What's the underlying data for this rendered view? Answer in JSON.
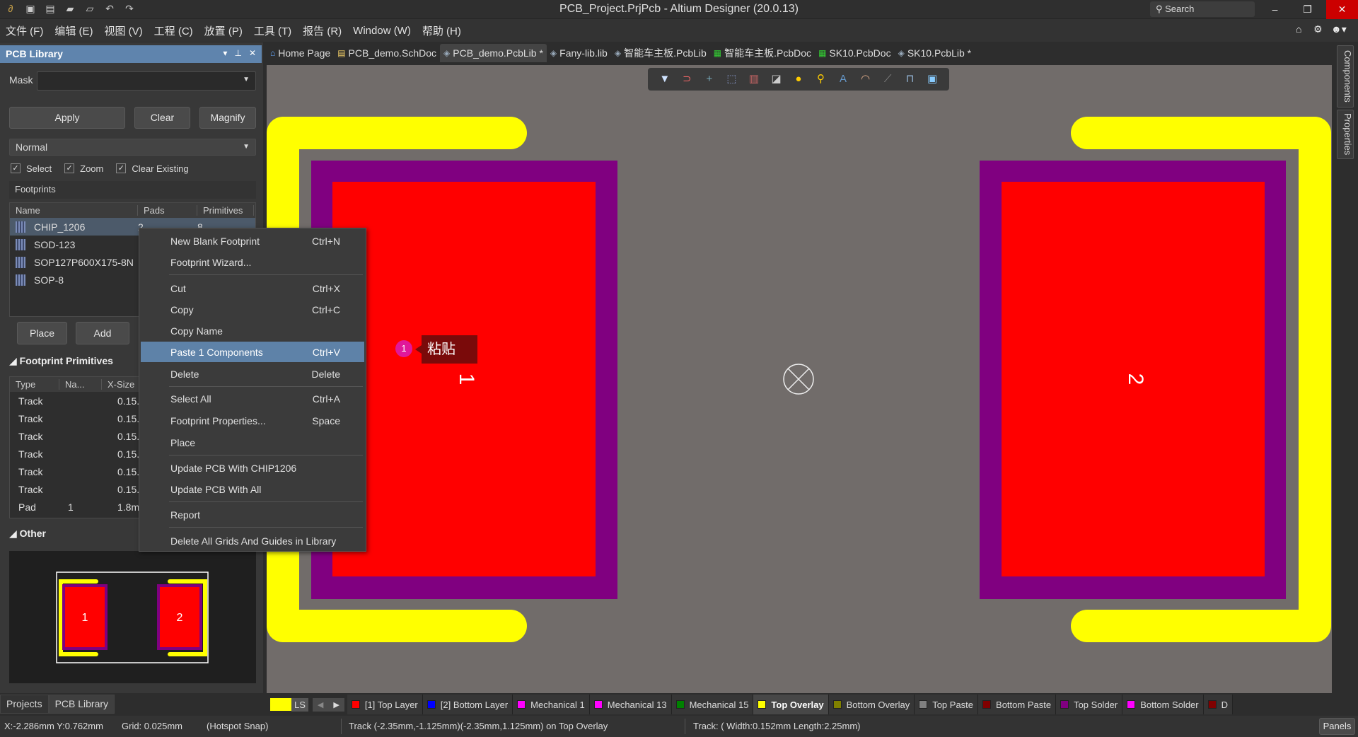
{
  "app": {
    "title": "PCB_Project.PrjPcb - Altium Designer (20.0.13)",
    "search_placeholder": "Search"
  },
  "quick_icons": [
    "app-logo-icon",
    "save-icon",
    "save-all-icon",
    "open-icon",
    "open-project-icon",
    "undo-icon",
    "redo-icon"
  ],
  "menu": [
    "文件 (F)",
    "编辑 (E)",
    "视图 (V)",
    "工程 (C)",
    "放置 (P)",
    "工具 (T)",
    "报告 (R)",
    "Window (W)",
    "帮助 (H)"
  ],
  "panel": {
    "title": "PCB Library",
    "mask_label": "Mask",
    "mask_value": "",
    "buttons": {
      "apply": "Apply",
      "clear": "Clear",
      "magnify": "Magnify"
    },
    "filter_mode": "Normal",
    "checks": [
      {
        "label": "Select",
        "checked": true
      },
      {
        "label": "Zoom",
        "checked": true
      },
      {
        "label": "Clear Existing",
        "checked": true
      }
    ],
    "footprints_label": "Footprints",
    "footprint_columns": [
      "Name",
      "Pads",
      "Primitives"
    ],
    "footprints": [
      {
        "name": "CHIP_1206",
        "pads": "2",
        "primitives": "8"
      },
      {
        "name": "SOD-123",
        "pads": "",
        "primitives": ""
      },
      {
        "name": "SOP127P600X175-8N",
        "pads": "",
        "primitives": ""
      },
      {
        "name": "SOP-8",
        "pads": "",
        "primitives": ""
      }
    ],
    "place": "Place",
    "add": "Add",
    "primitives_label": "Footprint Primitives",
    "primitive_columns": [
      "Type",
      "Na...",
      "X-Size"
    ],
    "primitives": [
      [
        "Track",
        "",
        "0.15..."
      ],
      [
        "Track",
        "",
        "0.15..."
      ],
      [
        "Track",
        "",
        "0.15..."
      ],
      [
        "Track",
        "",
        "0.15..."
      ],
      [
        "Track",
        "",
        "0.15..."
      ],
      [
        "Track",
        "",
        "0.15..."
      ],
      [
        "Pad",
        "1",
        "1.8m..."
      ]
    ],
    "other_label": "Other",
    "preview_pads": [
      "1",
      "2"
    ],
    "bottom_tabs": [
      "Projects",
      "PCB Library"
    ]
  },
  "doc_tabs": [
    {
      "label": "Home Page",
      "icon": "home-icon",
      "active": false
    },
    {
      "label": "PCB_demo.SchDoc",
      "icon": "schematic-icon",
      "active": false
    },
    {
      "label": "PCB_demo.PcbLib *",
      "icon": "pcblib-icon",
      "active": true
    },
    {
      "label": "Fany-lib.lib",
      "icon": "pcblib-icon",
      "active": false
    },
    {
      "label": "智能车主板.PcbLib",
      "icon": "pcblib-icon",
      "active": false
    },
    {
      "label": "智能车主板.PcbDoc",
      "icon": "pcbdoc-icon",
      "active": false
    },
    {
      "label": "SK10.PcbDoc",
      "icon": "pcbdoc-icon",
      "active": false
    },
    {
      "label": "SK10.PcbLib *",
      "icon": "pcblib-icon",
      "active": false
    }
  ],
  "toolbar": [
    "filter-icon",
    "route-icon",
    "crosshair-icon",
    "select-rect-icon",
    "align-icon",
    "component-icon",
    "pad-icon",
    "via-icon",
    "text-icon",
    "arc-icon",
    "line-icon",
    "dimension-icon",
    "area-icon"
  ],
  "right_tabs": [
    "Components",
    "Properties"
  ],
  "canvas": {
    "pad_labels": [
      "1",
      "2"
    ],
    "colors": {
      "overlay": "#ffff00",
      "solder": "#800080",
      "top_layer": "#ff0000",
      "background": "#716c6a"
    }
  },
  "context_menu": [
    {
      "label": "New Blank Footprint",
      "shortcut": "Ctrl+N"
    },
    {
      "label": "Footprint Wizard...",
      "shortcut": ""
    },
    {
      "label": "Cut",
      "shortcut": "Ctrl+X"
    },
    {
      "label": "Copy",
      "shortcut": "Ctrl+C"
    },
    {
      "label": "Copy Name",
      "shortcut": ""
    },
    {
      "label": "Paste 1 Components",
      "shortcut": "Ctrl+V",
      "highlighted": true
    },
    {
      "label": "Delete",
      "shortcut": "Delete"
    },
    {
      "label": "Select All",
      "shortcut": "Ctrl+A"
    },
    {
      "label": "Footprint Properties...",
      "shortcut": "Space"
    },
    {
      "label": "Place",
      "shortcut": ""
    },
    {
      "label": "Update PCB With CHIP1206",
      "shortcut": ""
    },
    {
      "label": "Update PCB With All",
      "shortcut": ""
    },
    {
      "label": "Report",
      "shortcut": ""
    },
    {
      "label": "Delete All Grids And Guides in Library",
      "shortcut": ""
    }
  ],
  "annotation": {
    "number": "1",
    "text": "粘贴"
  },
  "layers": {
    "current_color": "#ffff00",
    "ls": "LS",
    "tabs": [
      {
        "label": "[1] Top Layer",
        "color": "#ff0000"
      },
      {
        "label": "[2] Bottom Layer",
        "color": "#0000ff"
      },
      {
        "label": "Mechanical 1",
        "color": "#ff00ff"
      },
      {
        "label": "Mechanical 13",
        "color": "#ff00ff"
      },
      {
        "label": "Mechanical 15",
        "color": "#008000"
      },
      {
        "label": "Top Overlay",
        "color": "#ffff00",
        "active": true
      },
      {
        "label": "Bottom Overlay",
        "color": "#808000"
      },
      {
        "label": "Top Paste",
        "color": "#808080"
      },
      {
        "label": "Bottom Paste",
        "color": "#800000"
      },
      {
        "label": "Top Solder",
        "color": "#800080"
      },
      {
        "label": "Bottom Solder",
        "color": "#ff00ff"
      },
      {
        "label": "D",
        "color": "#800000"
      }
    ]
  },
  "status": {
    "coords": "X:-2.286mm Y:0.762mm",
    "grid": "Grid: 0.025mm",
    "snap": "(Hotspot Snap)",
    "object": "Track (-2.35mm,-1.125mm)(-2.35mm,1.125mm) on Top Overlay",
    "detail": "Track: ( Width:0.152mm Length:2.25mm)",
    "panels": "Panels"
  }
}
